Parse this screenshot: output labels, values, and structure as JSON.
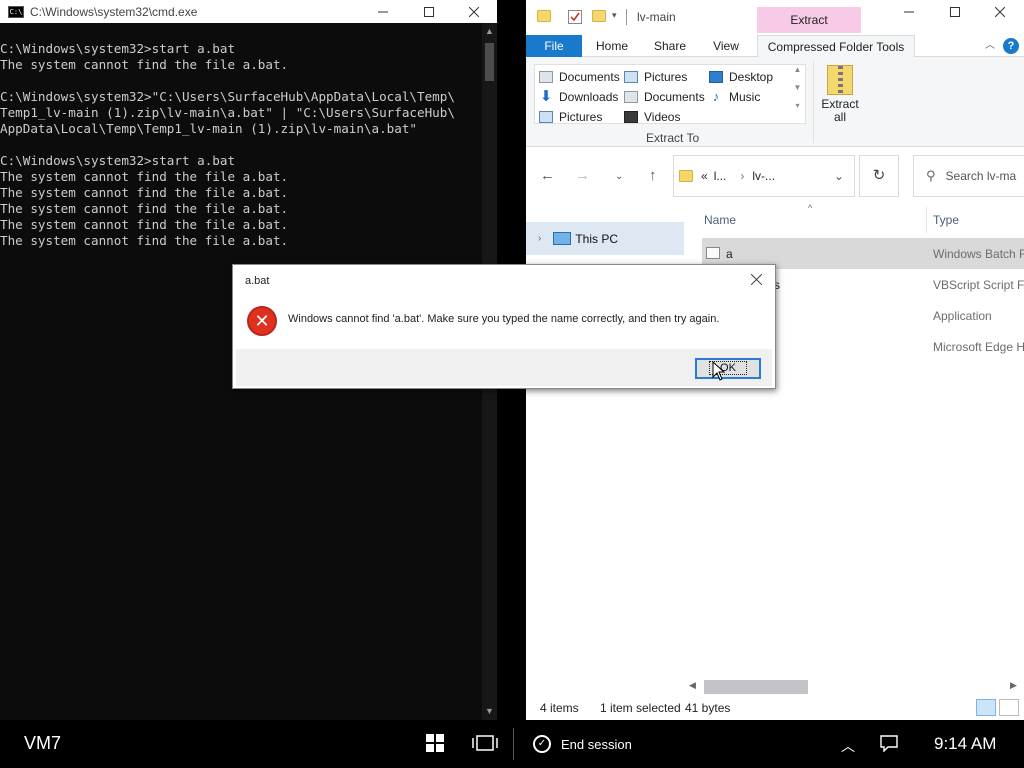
{
  "cmd_window": {
    "title": "C:\\Windows\\system32\\cmd.exe",
    "icon": "cmd-app-icon",
    "controls": [
      "minimize",
      "maximize",
      "close"
    ],
    "lines": [
      "C:\\Windows\\system32>start a.bat",
      "The system cannot find the file a.bat.",
      "",
      "C:\\Windows\\system32>\"C:\\Users\\SurfaceHub\\AppData\\Local\\Temp\\",
      "Temp1_lv-main (1).zip\\lv-main\\a.bat\" | \"C:\\Users\\SurfaceHub\\",
      "AppData\\Local\\Temp\\Temp1_lv-main (1).zip\\lv-main\\a.bat\"",
      "",
      "C:\\Windows\\system32>start a.bat",
      "The system cannot find the file a.bat.",
      "The system cannot find the file a.bat.",
      "The system cannot find the file a.bat.",
      "The system cannot find the file a.bat.",
      "The system cannot find the file a.bat."
    ]
  },
  "explorer": {
    "title": "lv-main",
    "contextual_tab": "Extract",
    "tabs": {
      "file": "File",
      "home": "Home",
      "share": "Share",
      "view": "View",
      "compressed": "Compressed Folder Tools"
    },
    "ribbon": {
      "gallery": [
        {
          "label": "Documents",
          "icon": "documents-icon"
        },
        {
          "label": "Pictures",
          "icon": "pictures-icon"
        },
        {
          "label": "Desktop",
          "icon": "desktop-icon"
        },
        {
          "label": "Downloads",
          "icon": "downloads-icon"
        },
        {
          "label": "Documents",
          "icon": "documents-icon"
        },
        {
          "label": "Music",
          "icon": "music-icon"
        },
        {
          "label": "Pictures",
          "icon": "pictures-icon"
        },
        {
          "label": "Videos",
          "icon": "videos-icon"
        }
      ],
      "group_label": "Extract To",
      "extract_all_line1": "Extract",
      "extract_all_line2": "all"
    },
    "address": {
      "prefix": "«",
      "segment1": "l...",
      "segment2": "lv-..."
    },
    "search_placeholder": "Search lv-ma",
    "nav_pane": {
      "item": "This PC"
    },
    "columns": {
      "name": "Name",
      "type": "Type"
    },
    "files": [
      {
        "name": "a",
        "type": "Windows Batch F",
        "selected": true
      },
      {
        "name": "s",
        "type": "VBScript Script F",
        "selected": false
      },
      {
        "name": "",
        "type": "Application",
        "selected": false
      },
      {
        "name": "",
        "type": "Microsoft Edge H",
        "selected": false
      }
    ],
    "status": {
      "items": "4 items",
      "selected": "1 item selected",
      "size": "41 bytes"
    }
  },
  "dialog": {
    "title": "a.bat",
    "message": "Windows cannot find 'a.bat'. Make sure you typed the name correctly, and then try again.",
    "ok_label": "OK",
    "icon": "error-icon"
  },
  "taskbar": {
    "vm_name": "VM7",
    "end_session": "End session",
    "clock": "9:14 AM"
  },
  "colors": {
    "console_bg": "#0c0c0c",
    "console_fg": "#cccccc",
    "file_tab": "#1979ca",
    "contextual_tab": "#f7cbe7",
    "selection": "#d9d9d9",
    "error_red": "#e0301e",
    "taskbar_bg": "#000000"
  }
}
